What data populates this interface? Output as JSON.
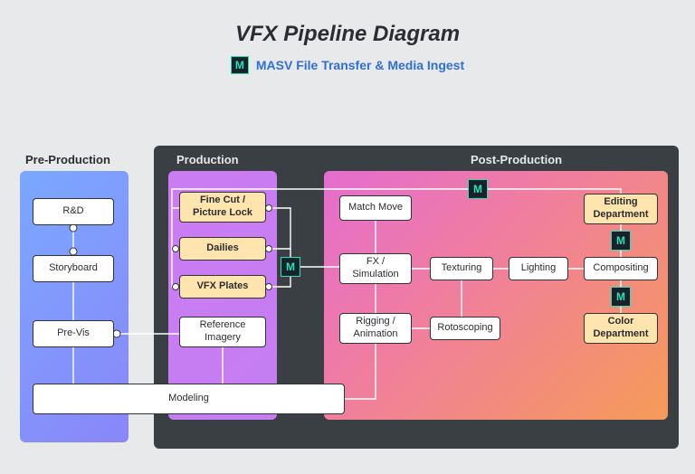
{
  "title": "VFX Pipeline Diagram",
  "subtitle": "MASV File Transfer & Media Ingest",
  "masv_glyph": "M",
  "columns": {
    "pre": "Pre-Production",
    "prod": "Production",
    "post": "Post-Production"
  },
  "nodes": {
    "rd": "R&D",
    "storyboard": "Storyboard",
    "previs": "Pre-Vis",
    "finecut": "Fine Cut / Picture Lock",
    "dailies": "Dailies",
    "vfxplates": "VFX Plates",
    "refimg": "Reference Imagery",
    "modeling": "Modeling",
    "matchmove": "Match Move",
    "fxsim": "FX / Simulation",
    "rigging": "Rigging / Animation",
    "texturing": "Texturing",
    "rotoscoping": "Rotoscoping",
    "lighting": "Lighting",
    "compositing": "Compositing",
    "editing": "Editing Department",
    "color": "Color Department"
  }
}
